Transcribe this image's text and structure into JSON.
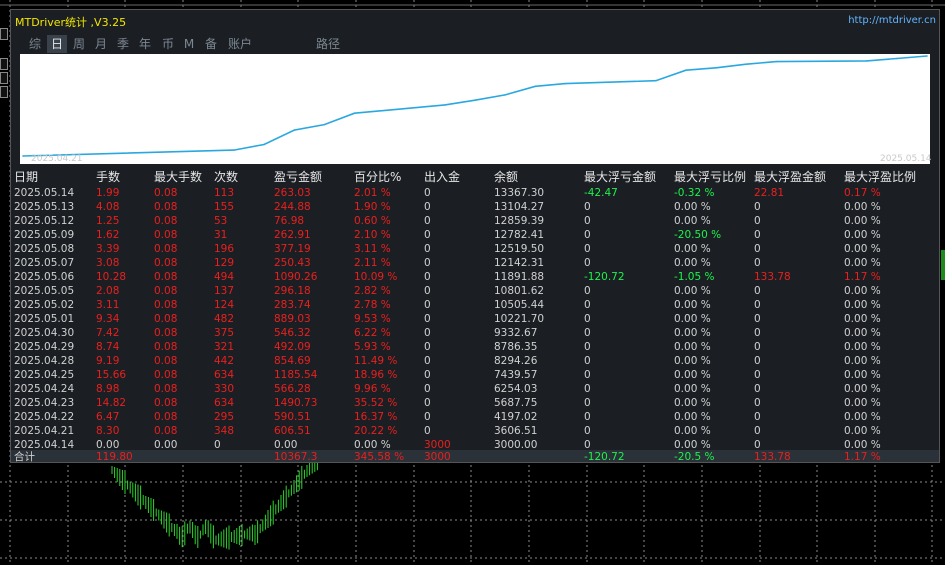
{
  "app": {
    "title": "MTDriver统计 ,V3.25",
    "url": "http://mtdriver.cn"
  },
  "tabs": [
    {
      "label": "综",
      "active": false
    },
    {
      "label": "日",
      "active": true
    },
    {
      "label": "周",
      "active": false
    },
    {
      "label": "月",
      "active": false
    },
    {
      "label": "季",
      "active": false
    },
    {
      "label": "年",
      "active": false
    },
    {
      "label": "币",
      "active": false
    },
    {
      "label": "M",
      "active": false
    },
    {
      "label": "备",
      "active": false
    },
    {
      "label": "账户",
      "active": false
    },
    {
      "label": "路径",
      "active": false
    }
  ],
  "chart_data": {
    "type": "line",
    "x": [
      "2025.04.14",
      "2025.04.21",
      "2025.04.22",
      "2025.04.23",
      "2025.04.24",
      "2025.04.25",
      "2025.04.28",
      "2025.04.29",
      "2025.04.30",
      "2025.05.01",
      "2025.05.02",
      "2025.05.05",
      "2025.05.06",
      "2025.05.07",
      "2025.05.08",
      "2025.05.09",
      "2025.05.12",
      "2025.05.13",
      "2025.05.14"
    ],
    "values": [
      3000.0,
      3606.51,
      4197.02,
      5687.75,
      6254.03,
      7439.57,
      8294.26,
      8786.35,
      9332.67,
      10221.7,
      10505.44,
      10801.62,
      11891.88,
      12142.31,
      12519.5,
      12782.41,
      12859.39,
      13104.27,
      13367.3
    ],
    "x_start_label": "2025.04.21",
    "x_end_label": "2025.05.14",
    "line_color": "#29a8e0",
    "grid": false
  },
  "table": {
    "headers": [
      "日期",
      "手数",
      "最大手数",
      "次数",
      "盈亏金额",
      "百分比%",
      "出入金",
      "余额",
      "最大浮亏金额",
      "最大浮亏比例",
      "最大浮盈金额",
      "最大浮盈比例"
    ],
    "rows": [
      [
        "2025.05.14",
        "1.99",
        "0.08",
        "113",
        "263.03",
        "2.01 %",
        "0",
        "13367.30",
        "-42.47",
        "-0.32 %",
        "22.81",
        "0.17 %"
      ],
      [
        "2025.05.13",
        "4.08",
        "0.08",
        "155",
        "244.88",
        "1.90 %",
        "0",
        "13104.27",
        "0",
        "0.00 %",
        "0",
        "0.00 %"
      ],
      [
        "2025.05.12",
        "1.25",
        "0.08",
        "53",
        "76.98",
        "0.60 %",
        "0",
        "12859.39",
        "0",
        "0.00 %",
        "0",
        "0.00 %"
      ],
      [
        "2025.05.09",
        "1.62",
        "0.08",
        "31",
        "262.91",
        "2.10 %",
        "0",
        "12782.41",
        "0",
        "-20.50 %",
        "0",
        "0.00 %"
      ],
      [
        "2025.05.08",
        "3.39",
        "0.08",
        "196",
        "377.19",
        "3.11 %",
        "0",
        "12519.50",
        "0",
        "0.00 %",
        "0",
        "0.00 %"
      ],
      [
        "2025.05.07",
        "3.08",
        "0.08",
        "129",
        "250.43",
        "2.11 %",
        "0",
        "12142.31",
        "0",
        "0.00 %",
        "0",
        "0.00 %"
      ],
      [
        "2025.05.06",
        "10.28",
        "0.08",
        "494",
        "1090.26",
        "10.09 %",
        "0",
        "11891.88",
        "-120.72",
        "-1.05 %",
        "133.78",
        "1.17 %"
      ],
      [
        "2025.05.05",
        "2.08",
        "0.08",
        "137",
        "296.18",
        "2.82 %",
        "0",
        "10801.62",
        "0",
        "0.00 %",
        "0",
        "0.00 %"
      ],
      [
        "2025.05.02",
        "3.11",
        "0.08",
        "124",
        "283.74",
        "2.78 %",
        "0",
        "10505.44",
        "0",
        "0.00 %",
        "0",
        "0.00 %"
      ],
      [
        "2025.05.01",
        "9.34",
        "0.08",
        "482",
        "889.03",
        "9.53 %",
        "0",
        "10221.70",
        "0",
        "0.00 %",
        "0",
        "0.00 %"
      ],
      [
        "2025.04.30",
        "7.42",
        "0.08",
        "375",
        "546.32",
        "6.22 %",
        "0",
        "9332.67",
        "0",
        "0.00 %",
        "0",
        "0.00 %"
      ],
      [
        "2025.04.29",
        "8.74",
        "0.08",
        "321",
        "492.09",
        "5.93 %",
        "0",
        "8786.35",
        "0",
        "0.00 %",
        "0",
        "0.00 %"
      ],
      [
        "2025.04.28",
        "9.19",
        "0.08",
        "442",
        "854.69",
        "11.49 %",
        "0",
        "8294.26",
        "0",
        "0.00 %",
        "0",
        "0.00 %"
      ],
      [
        "2025.04.25",
        "15.66",
        "0.08",
        "634",
        "1185.54",
        "18.96 %",
        "0",
        "7439.57",
        "0",
        "0.00 %",
        "0",
        "0.00 %"
      ],
      [
        "2025.04.24",
        "8.98",
        "0.08",
        "330",
        "566.28",
        "9.96 %",
        "0",
        "6254.03",
        "0",
        "0.00 %",
        "0",
        "0.00 %"
      ],
      [
        "2025.04.23",
        "14.82",
        "0.08",
        "634",
        "1490.73",
        "35.52 %",
        "0",
        "5687.75",
        "0",
        "0.00 %",
        "0",
        "0.00 %"
      ],
      [
        "2025.04.22",
        "6.47",
        "0.08",
        "295",
        "590.51",
        "16.37 %",
        "0",
        "4197.02",
        "0",
        "0.00 %",
        "0",
        "0.00 %"
      ],
      [
        "2025.04.21",
        "8.30",
        "0.08",
        "348",
        "606.51",
        "20.22 %",
        "0",
        "3606.51",
        "0",
        "0.00 %",
        "0",
        "0.00 %"
      ],
      [
        "2025.04.14",
        "0.00",
        "0.00",
        "0",
        "0.00",
        "0.00 %",
        "3000",
        "3000.00",
        "0",
        "0.00 %",
        "0",
        "0.00 %"
      ]
    ],
    "total": [
      "合计",
      "119.80",
      "",
      "",
      "10367.3",
      "345.58 %",
      "3000",
      "",
      "-120.72",
      "-20.5 %",
      "133.78",
      "1.17 %"
    ]
  },
  "colors": {
    "panel_bg": "#1b1f24",
    "title": "#f2e600",
    "url": "#63b4ff",
    "positive": "#e8201e",
    "negative": "#1cf24c",
    "neutral": "#d0d0d0",
    "line": "#29a8e0"
  }
}
